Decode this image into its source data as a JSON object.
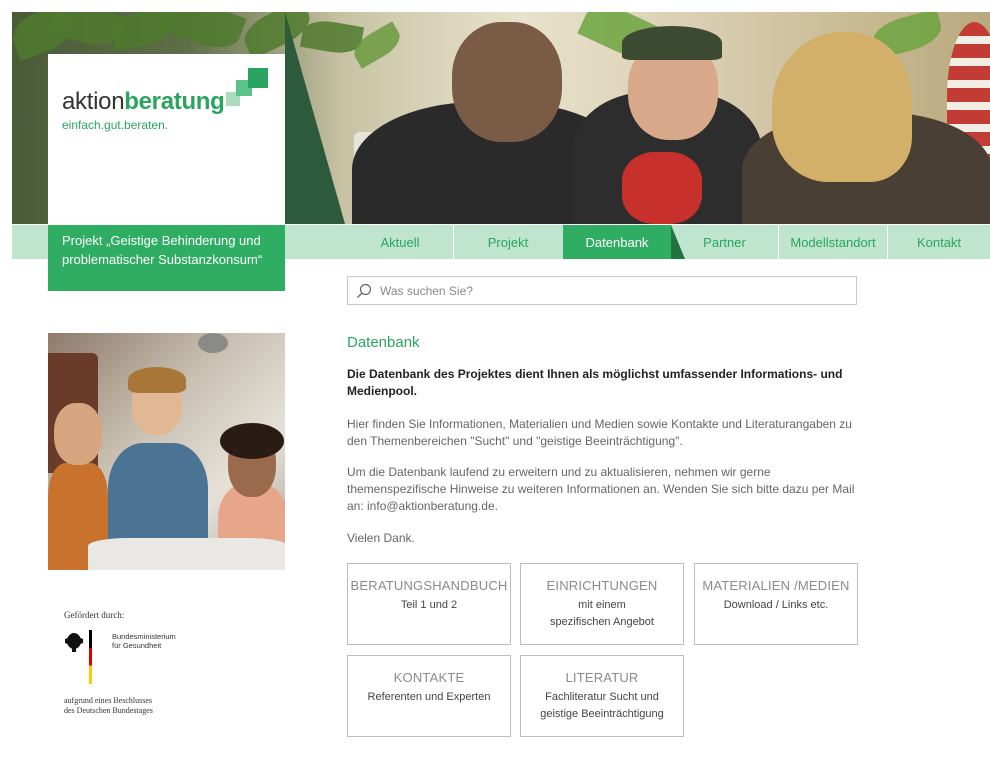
{
  "logo": {
    "name_light": "aktion",
    "name_bold": "beratung",
    "tagline": "einfach.gut.beraten.",
    "colors": {
      "light": "#a9dcbf",
      "mid": "#5bc28a",
      "dark": "#2aa55f"
    }
  },
  "project": {
    "title": "Projekt „Geistige Behinderung und problematischer Substanzkonsum“"
  },
  "nav": {
    "items": [
      {
        "label": "Aktuell",
        "active": false
      },
      {
        "label": "Projekt",
        "active": false
      },
      {
        "label": "Datenbank",
        "active": true
      },
      {
        "label": "Partner",
        "active": false
      },
      {
        "label": "Modellstandort",
        "active": false
      },
      {
        "label": "Kontakt",
        "active": false
      }
    ]
  },
  "search": {
    "placeholder": "Was suchen Sie?",
    "icon": "search-icon"
  },
  "main": {
    "title": "Datenbank",
    "intro": "Die Datenbank des Projektes dient Ihnen als möglichst umfassender Informations- und Medienpool.",
    "paragraph1": "Hier finden Sie Informationen, Materialien und Medien sowie Kontakte und Literaturangaben zu den Themenbereichen \"Sucht\" und \"geistige Beeinträchtigung\".",
    "paragraph2": "Um die Datenbank laufend zu erweitern und zu aktualisieren, nehmen wir gerne themenspezifische Hinweise zu weiteren Informationen an. Wenden Sie sich bitte dazu per Mail an: info@aktionberatung.de.",
    "thanks": "Vielen Dank."
  },
  "cards": [
    {
      "title": "BERATUNGSHANDBUCH",
      "subtitle": "Teil 1 und 2"
    },
    {
      "title": "EINRICHTUNGEN",
      "subtitle": "mit einem spezifischen Angebot"
    },
    {
      "title": "MATERIALIEN /MEDIEN",
      "subtitle": "Download / Links etc."
    },
    {
      "title": "KONTAKTE",
      "subtitle": "Referenten und Experten"
    },
    {
      "title": "LITERATUR",
      "subtitle": "Fachliteratur Sucht und geistige Beeinträchtigung"
    }
  ],
  "funding": {
    "label": "Gefördert durch:",
    "ministry_line1": "Bundesministerium",
    "ministry_line2": "für Gesundheit",
    "resolution_line1": "aufgrund eines Beschlusses",
    "resolution_line2": "des Deutschen Bundestages"
  },
  "colors": {
    "accent": "#2fae63",
    "accent_text": "#2aa55f",
    "nav_bg": "#bfe5cf"
  }
}
